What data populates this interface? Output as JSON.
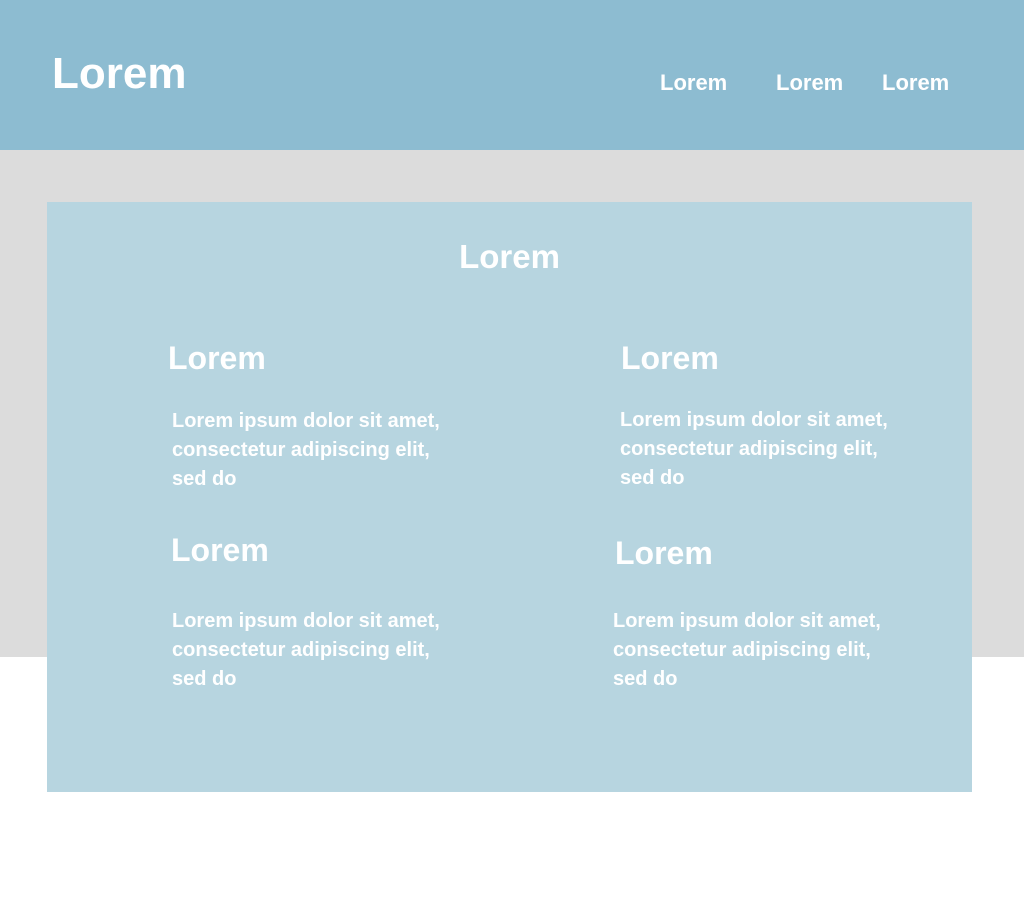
{
  "header": {
    "logo": "Lorem",
    "nav": [
      "Lorem",
      "Lorem",
      "Lorem"
    ]
  },
  "main": {
    "title": "Lorem",
    "features": [
      {
        "title": "Lorem",
        "text": "Lorem ipsum dolor sit amet, consectetur adipiscing elit, sed do"
      },
      {
        "title": "Lorem",
        "text": "Lorem ipsum dolor sit amet, consectetur adipiscing elit, sed do"
      },
      {
        "title": "Lorem",
        "text": "Lorem ipsum dolor sit amet, consectetur adipiscing elit, sed do"
      },
      {
        "title": "Lorem",
        "text": "Lorem ipsum dolor sit amet, consectetur adipiscing elit, sed do"
      }
    ]
  },
  "colors": {
    "header_bg": "#8dbcd1",
    "band_bg": "#dcdcdc",
    "card_bg": "#b7d5e0",
    "text": "#ffffff"
  }
}
